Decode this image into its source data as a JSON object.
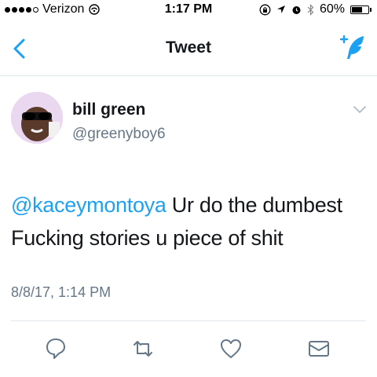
{
  "status_bar": {
    "carrier": "Verizon",
    "time": "1:17 PM",
    "battery": "60%",
    "battery_level": 0.6,
    "icons": [
      "signal-dots-icon",
      "wifi-icon",
      "lock-rotation-icon",
      "location-icon",
      "alarm-icon",
      "bluetooth-icon",
      "battery-icon"
    ]
  },
  "nav": {
    "title": "Tweet",
    "back_icon": "chevron-left-icon",
    "compose_icon": "compose-tweet-icon"
  },
  "tweet": {
    "author_name": "bill green",
    "author_handle": "@greenyboy6",
    "mention": "@kaceymontoya",
    "body_line1": " Ur do the dumbest",
    "body_line2": "Fucking stories u piece of shit",
    "timestamp": "8/8/17, 1:14 PM"
  },
  "actions": {
    "reply_icon": "reply-icon",
    "retweet_icon": "retweet-icon",
    "like_icon": "heart-icon",
    "message_icon": "envelope-icon"
  },
  "colors": {
    "accent": "#1da1f2",
    "text": "#14171a",
    "secondary": "#657786",
    "icon_gray": "#657786",
    "divider": "#e1e8ed"
  }
}
